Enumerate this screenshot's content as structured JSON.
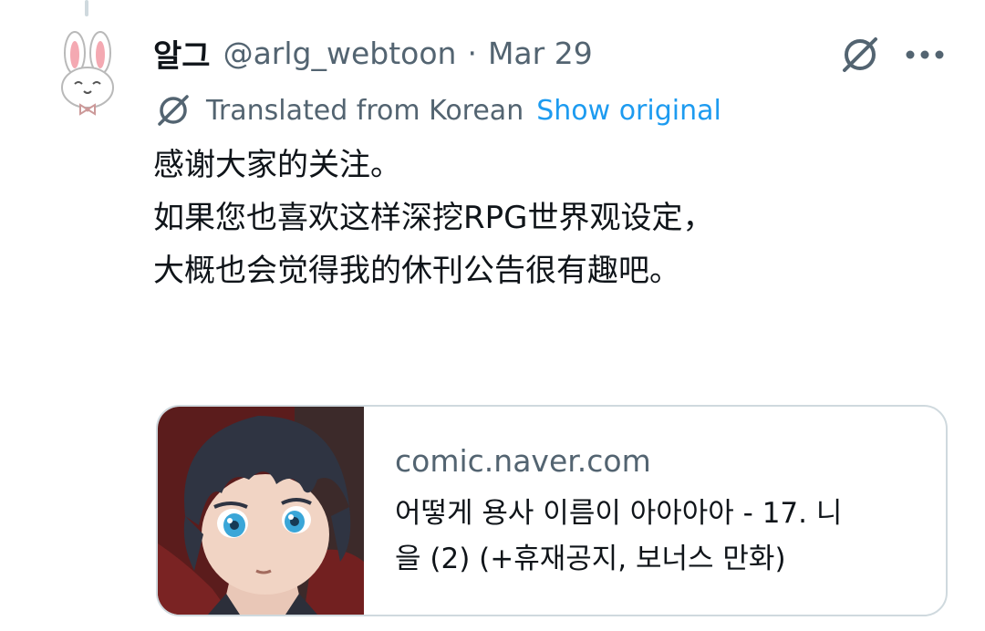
{
  "tweet": {
    "display_name": "알그",
    "handle": "@arlg_webtoon",
    "separator": "·",
    "date": "Mar 29",
    "translated_label": "Translated from Korean",
    "show_original_label": "Show original",
    "body_lines": [
      "感谢大家的关注。",
      "如果您也喜欢这样深挖RPG世界观设定，",
      "大概也会觉得我的休刊公告很有趣吧。"
    ]
  },
  "card": {
    "domain": "comic.naver.com",
    "title_lines": [
      "어떻게 용사 이름이 아아아아 - 17. 니",
      "을 (2) (+휴재공지, 보너스 만화)"
    ]
  },
  "icons": {
    "avatar": "bunny-avatar",
    "grok": "grok-icon",
    "more": "more-icon",
    "translate": "grok-translate-icon"
  },
  "colors": {
    "text_primary": "#0f1419",
    "text_secondary": "#536471",
    "link": "#1d9bf0",
    "border": "#cfd9de"
  }
}
